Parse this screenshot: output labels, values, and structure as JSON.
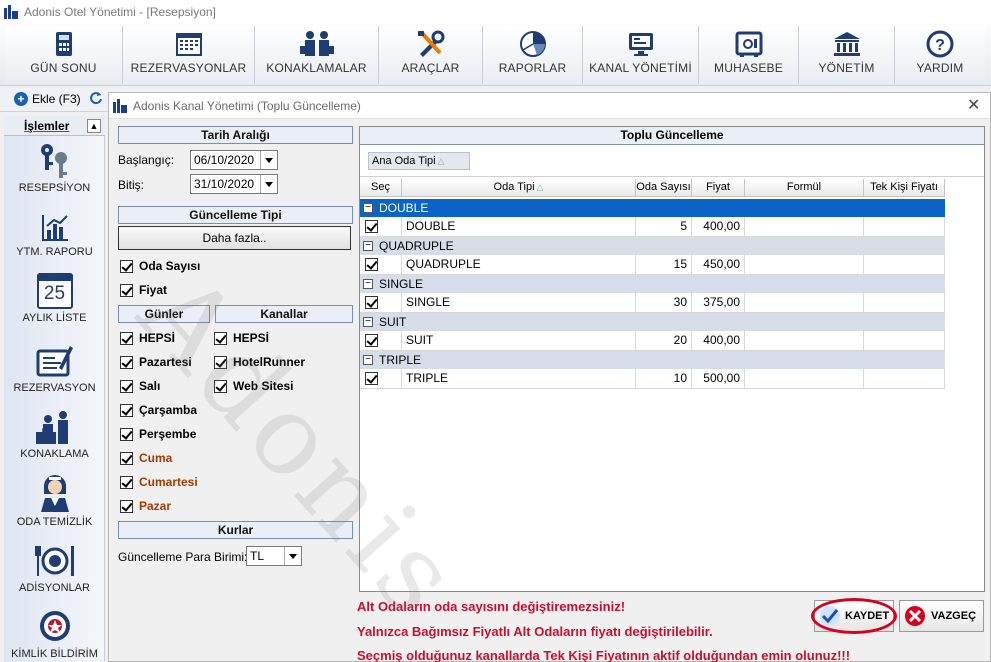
{
  "window": {
    "title": "Adonis Otel Yönetimi - [Resepsiyon]"
  },
  "toolbar": {
    "items": [
      {
        "label": "GÜN SONU",
        "icon": "calculator-icon"
      },
      {
        "label": "REZERVASYONLAR",
        "icon": "calendar-icon"
      },
      {
        "label": "KONAKLAMALAR",
        "icon": "guests-icon"
      },
      {
        "label": "ARAÇLAR",
        "icon": "tools-icon"
      },
      {
        "label": "RAPORLAR",
        "icon": "pie-chart-icon"
      },
      {
        "label": "KANAL YÖNETİMİ",
        "icon": "monitor-icon"
      },
      {
        "label": "MUHASEBE",
        "icon": "safe-icon"
      },
      {
        "label": "YÖNETİM",
        "icon": "bank-icon"
      },
      {
        "label": "YARDIM",
        "icon": "help-icon"
      }
    ]
  },
  "subtoolbar": {
    "add_label": "Ekle (F3)"
  },
  "sidebar": {
    "header": "İşlemler",
    "items": [
      {
        "label": "RESEPSİYON",
        "icon": "keys-icon"
      },
      {
        "label": "YTM. RAPORU",
        "icon": "bar-chart-icon"
      },
      {
        "label": "AYLIK LİSTE",
        "icon": "calendar-25-icon",
        "day": "25"
      },
      {
        "label": "REZERVASYON",
        "icon": "form-pen-icon"
      },
      {
        "label": "KONAKLAMA",
        "icon": "bellboy-icon"
      },
      {
        "label": "ODA TEMİZLİK",
        "icon": "housekeeper-icon"
      },
      {
        "label": "ADİSYONLAR",
        "icon": "dining-icon"
      },
      {
        "label": "KİMLİK BİLDİRİM",
        "icon": "police-badge-icon"
      }
    ]
  },
  "dialog": {
    "title": "Adonis Kanal Yönetimi (Toplu Güncelleme)",
    "date_range": {
      "header": "Tarih Aralığı",
      "start_label": "Başlangıç:",
      "start_value": "06/10/2020",
      "end_label": "Bitiş:",
      "end_value": "31/10/2020"
    },
    "update_type": {
      "header": "Güncelleme Tipi",
      "more_button": "Daha fazla..",
      "options": [
        {
          "label": "Oda Sayısı",
          "checked": true
        },
        {
          "label": "Fiyat",
          "checked": true
        }
      ]
    },
    "days": {
      "header": "Günler",
      "items": [
        {
          "label": "HEPSİ",
          "checked": true,
          "weekend": false
        },
        {
          "label": "Pazartesi",
          "checked": true,
          "weekend": false
        },
        {
          "label": "Salı",
          "checked": true,
          "weekend": false
        },
        {
          "label": "Çarşamba",
          "checked": true,
          "weekend": false
        },
        {
          "label": "Perşembe",
          "checked": true,
          "weekend": false
        },
        {
          "label": "Cuma",
          "checked": true,
          "weekend": true
        },
        {
          "label": "Cumartesi",
          "checked": true,
          "weekend": true
        },
        {
          "label": "Pazar",
          "checked": true,
          "weekend": true
        }
      ]
    },
    "channels": {
      "header": "Kanallar",
      "items": [
        {
          "label": "HEPSİ",
          "checked": true
        },
        {
          "label": "HotelRunner",
          "checked": true
        },
        {
          "label": "Web Sitesi",
          "checked": true
        }
      ]
    },
    "rates": {
      "header": "Kurlar",
      "currency_label": "Güncelleme Para Birimi:",
      "currency_value": "TL"
    },
    "grid": {
      "title": "Toplu Güncelleme",
      "group_by": "Ana Oda Tipi",
      "sort_mark": "△",
      "columns": [
        "Seç",
        "Oda Tipi",
        "Oda Sayısı",
        "Fiyat",
        "Formül",
        "Tek Kişi Fiyatı"
      ],
      "groups": [
        {
          "name": "DOUBLE",
          "selected": true,
          "rows": [
            {
              "checked": true,
              "room_type": "DOUBLE",
              "count": "5",
              "price": "400,00",
              "formula": "",
              "single_price": ""
            }
          ]
        },
        {
          "name": "QUADRUPLE",
          "selected": false,
          "rows": [
            {
              "checked": true,
              "room_type": "QUADRUPLE",
              "count": "15",
              "price": "450,00",
              "formula": "",
              "single_price": ""
            }
          ]
        },
        {
          "name": "SINGLE",
          "selected": false,
          "rows": [
            {
              "checked": true,
              "room_type": "SINGLE",
              "count": "30",
              "price": "375,00",
              "formula": "",
              "single_price": ""
            }
          ]
        },
        {
          "name": "SUIT",
          "selected": false,
          "rows": [
            {
              "checked": true,
              "room_type": "SUIT",
              "count": "20",
              "price": "400,00",
              "formula": "",
              "single_price": ""
            }
          ]
        },
        {
          "name": "TRIPLE",
          "selected": false,
          "rows": [
            {
              "checked": true,
              "room_type": "TRIPLE",
              "count": "10",
              "price": "500,00",
              "formula": "",
              "single_price": ""
            }
          ]
        }
      ]
    },
    "warnings": [
      "Alt Odaların oda sayısını değiştiremezsiniz!",
      "Yalnızca Bağımsız Fiyatlı Alt Odaların fiyatı değiştirilebilir.",
      "Seçmiş olduğunuz kanallarda Tek Kişi Fiyatının aktif olduğundan emin olunuz!!!"
    ],
    "buttons": {
      "save": "KAYDET",
      "cancel": "VAZGEÇ"
    },
    "watermark": "Adonis"
  },
  "colors": {
    "accent_blue": "#0a63c7",
    "warning_red": "#c8102e",
    "weekend_orange": "#a33a00",
    "highlight_ring": "#d8001a"
  }
}
